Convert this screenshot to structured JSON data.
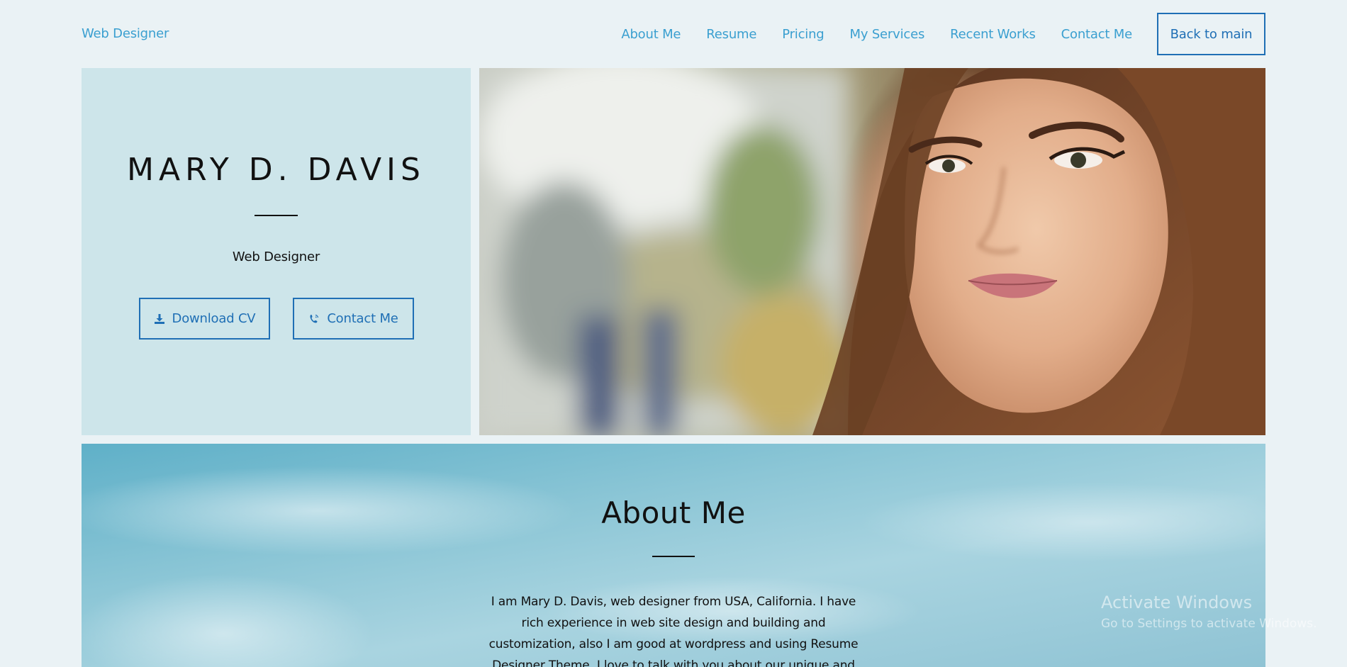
{
  "header": {
    "brand": "Web Designer",
    "nav": [
      "About Me",
      "Resume",
      "Pricing",
      "My Services",
      "Recent Works",
      "Contact Me"
    ],
    "back_button": "Back to main"
  },
  "hero": {
    "name": "MARY D. DAVIS",
    "title": "Web Designer",
    "download_cv": "Download CV",
    "contact_me": "Contact Me"
  },
  "about": {
    "heading": "About Me",
    "paragraph": "I am Mary D. Davis, web designer from USA, California. I have rich experience in web site design and building and customization, also I am good at wordpress and using Resume Designer Theme. I love to talk with you about our unique and Resume Designer Template"
  },
  "watermark": {
    "line1": "Activate Windows",
    "line2": "Go to Settings to activate Windows."
  },
  "colors": {
    "accent": "#1f6fb5",
    "link": "#3a9fd0",
    "hero_panel": "#cde5ea",
    "background": "#eaf2f5"
  },
  "icons": [
    "download-icon",
    "phone-icon"
  ]
}
